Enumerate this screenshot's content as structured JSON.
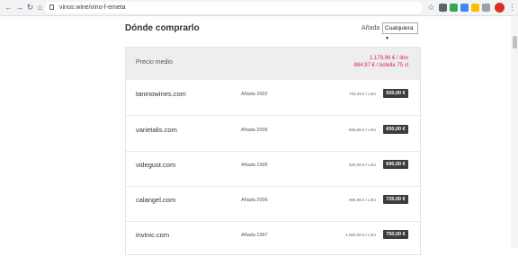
{
  "browser": {
    "url": "vinos.wine/vino-f-emeta",
    "back_icon": "arrow-left-icon",
    "forward_icon": "arrow-right-icon",
    "reload_icon": "reload-icon",
    "home_icon": "home-icon"
  },
  "header": {
    "title": "Dónde comprarlo",
    "vintage_label": "Añada",
    "vintage_selected": "Cualquiera"
  },
  "average": {
    "label": "Precio medio",
    "per_liter": "1.179,96 € / litro",
    "per_bottle": "884,97 € / botella 75 cl"
  },
  "offers": [
    {
      "store": "taninowines.com",
      "year": "Añada 2002",
      "per_liter": "733,33 € / Litro",
      "price": "550,00 €"
    },
    {
      "store": "varietalis.com",
      "year": "Añada 2006",
      "per_liter": "866,66 € / Litro",
      "price": "650,00 €"
    },
    {
      "store": "videgust.com",
      "year": "Añada 1995",
      "per_liter": "920,00 € / Litro",
      "price": "690,00 €"
    },
    {
      "store": "calangel.com",
      "year": "Añada 2006",
      "per_liter": "966,66 € / Litro",
      "price": "725,00 €"
    },
    {
      "store": "invinic.com",
      "year": "Añada 1997",
      "per_liter": "1.000,00 € / Litro",
      "price": "750,00 €"
    }
  ],
  "colors": {
    "accent_red": "#e0234b",
    "price_button_bg": "#3c3c3c",
    "avg_bg": "#eeeeee"
  }
}
